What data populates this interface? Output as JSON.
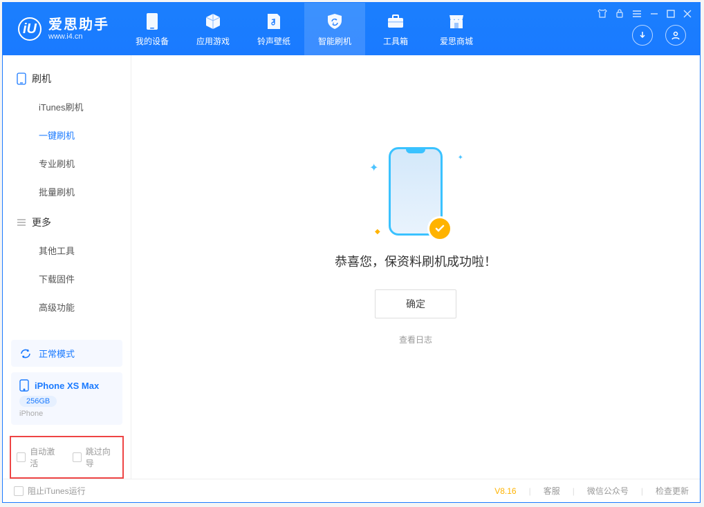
{
  "app": {
    "name_cn": "爱思助手",
    "site": "www.i4.cn",
    "logo_letter": "iU"
  },
  "nav": {
    "items": [
      {
        "label": "我的设备"
      },
      {
        "label": "应用游戏"
      },
      {
        "label": "铃声壁纸"
      },
      {
        "label": "智能刷机"
      },
      {
        "label": "工具箱"
      },
      {
        "label": "爱思商城"
      }
    ],
    "active_index": 3
  },
  "sidebar": {
    "groups": [
      {
        "title": "刷机",
        "items": [
          "iTunes刷机",
          "一键刷机",
          "专业刷机",
          "批量刷机"
        ],
        "active_index": 1
      },
      {
        "title": "更多",
        "items": [
          "其他工具",
          "下载固件",
          "高级功能"
        ],
        "active_index": -1
      }
    ],
    "mode_label": "正常模式",
    "device": {
      "name": "iPhone XS Max",
      "storage": "256GB",
      "type": "iPhone"
    },
    "options": {
      "auto_activate": "自动激活",
      "skip_guide": "跳过向导"
    }
  },
  "main": {
    "message": "恭喜您，保资料刷机成功啦！",
    "confirm_label": "确定",
    "log_link": "查看日志"
  },
  "footer": {
    "block_itunes": "阻止iTunes运行",
    "version": "V8.16",
    "links": [
      "客服",
      "微信公众号",
      "检查更新"
    ]
  }
}
